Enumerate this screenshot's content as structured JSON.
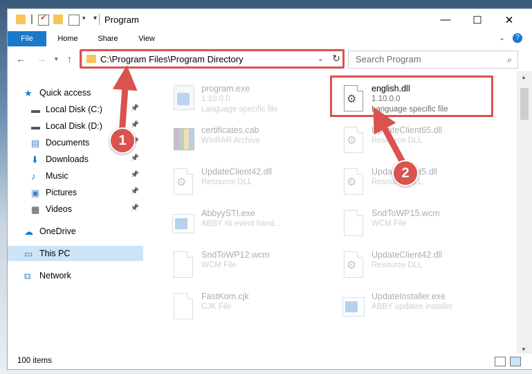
{
  "window": {
    "title": "Program"
  },
  "ribbon": {
    "tabs": [
      "File",
      "Home",
      "Share",
      "View"
    ]
  },
  "address": {
    "path": "C:\\Program Files\\Program Directory"
  },
  "search": {
    "placeholder": "Search Program"
  },
  "sidebar": {
    "items": [
      {
        "label": "Quick access",
        "icon": "star-icon",
        "pinned": false
      },
      {
        "label": "Local Disk (C:)",
        "icon": "drive-icon",
        "pinned": true
      },
      {
        "label": "Local Disk (D:)",
        "icon": "drive-icon",
        "pinned": true
      },
      {
        "label": "Documents",
        "icon": "documents-icon",
        "pinned": true
      },
      {
        "label": "Downloads",
        "icon": "download-icon",
        "pinned": true
      },
      {
        "label": "Music",
        "icon": "music-icon",
        "pinned": true
      },
      {
        "label": "Pictures",
        "icon": "pictures-icon",
        "pinned": true
      },
      {
        "label": "Videos",
        "icon": "videos-icon",
        "pinned": true
      },
      {
        "label": "OneDrive",
        "icon": "cloud-icon",
        "pinned": false
      },
      {
        "label": "This PC",
        "icon": "computer-icon",
        "pinned": false,
        "selected": true
      },
      {
        "label": "Network",
        "icon": "network-icon",
        "pinned": false
      }
    ]
  },
  "files": [
    {
      "name": "program.exe",
      "line2": "1.10.0.0",
      "line3": "Language specific file",
      "icon": "exe-icon",
      "faded": true
    },
    {
      "name": "english.dll",
      "line2": "1.10.0.0",
      "line3": "Language specific file",
      "icon": "dll-icon",
      "faded": false,
      "highlighted": true
    },
    {
      "name": "certificates.cab",
      "line2": "WinRAR Archive",
      "line3": "",
      "icon": "archive-icon",
      "faded": true
    },
    {
      "name": "UpdateClient65.dll",
      "line2": "Resource DLL",
      "line3": "",
      "icon": "dll-icon",
      "faded": true
    },
    {
      "name": "UpdateClient42.dll",
      "line2": "Resource DLL",
      "line3": "",
      "icon": "dll-icon",
      "faded": true
    },
    {
      "name": "UpdateClient5.dll",
      "line2": "Resource DLL",
      "line3": "",
      "icon": "dll-icon",
      "faded": true
    },
    {
      "name": "AbbyySTI.exe",
      "line2": "ABBY sti event hand...",
      "line3": "",
      "icon": "app-icon",
      "faded": true
    },
    {
      "name": "SndToWP15.wcm",
      "line2": "WCM File",
      "line3": "",
      "icon": "file-icon",
      "faded": true
    },
    {
      "name": "SndToWP12.wcm",
      "line2": "WCM File",
      "line3": "",
      "icon": "file-icon",
      "faded": true
    },
    {
      "name": "UpdateClient42.dll",
      "line2": "Resource DLL",
      "line3": "",
      "icon": "dll-icon",
      "faded": true
    },
    {
      "name": "FastKom.cjk",
      "line2": "CJK File",
      "line3": "",
      "icon": "file-icon",
      "faded": true
    },
    {
      "name": "UpdateInstaller.exe",
      "line2": "ABBY updates installer",
      "line3": "",
      "icon": "app-icon",
      "faded": true
    }
  ],
  "status": {
    "item_count": "100 items"
  },
  "annotations": {
    "marker1": "1",
    "marker2": "2",
    "color": "#d9534f"
  }
}
